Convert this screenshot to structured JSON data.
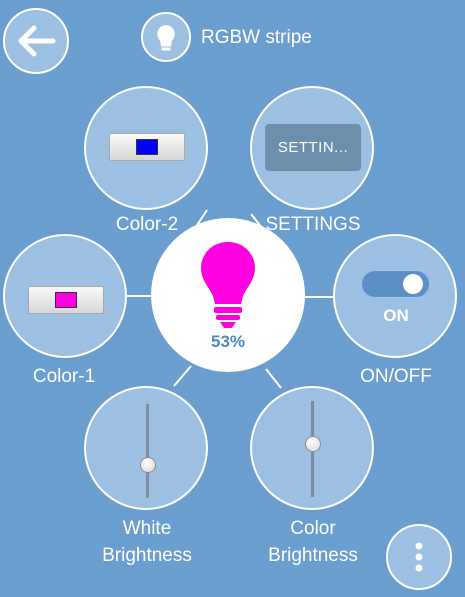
{
  "header": {
    "title": "RGBW stripe",
    "back_icon": "arrow-left-icon",
    "device_icon": "lightbulb-icon"
  },
  "center": {
    "bulb_color": "#ff00e1",
    "brightness_label": "53%"
  },
  "controls": {
    "color2": {
      "label": "Color-2",
      "swatch_color": "#0000ff"
    },
    "color1": {
      "label": "Color-1",
      "swatch_color": "#ff00e1"
    },
    "settings": {
      "label": "SETTINGS",
      "button_text": "SETTIN..."
    },
    "onoff": {
      "label": "ON/OFF",
      "state_text": "ON",
      "is_on": true
    },
    "white_brightness": {
      "label_line1": "White",
      "label_line2": "Brightness",
      "level": 0.35
    },
    "color_brightness": {
      "label_line1": "Color",
      "label_line2": "Brightness",
      "level": 0.55
    }
  },
  "menu": {
    "icon": "more-vertical-icon"
  },
  "colors": {
    "background": "#6a9ecf",
    "circle_fill": "#9cc0e2",
    "accent_text": "#4a89c3",
    "toggle_track": "#5b8fc6"
  }
}
